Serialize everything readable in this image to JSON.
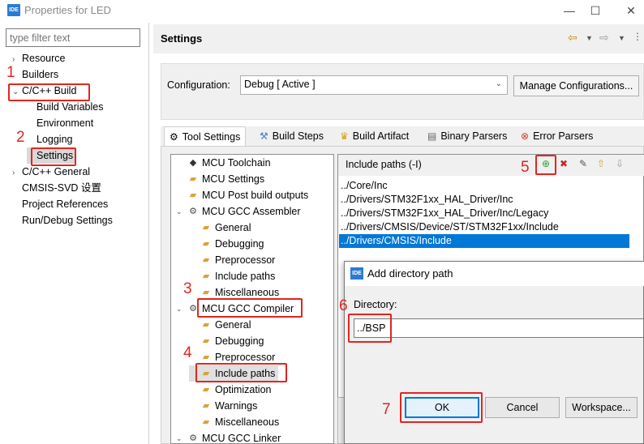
{
  "window": {
    "logo": "IDE",
    "title": "Properties for LED",
    "minimize": "—",
    "maximize": "☐",
    "close": "✕"
  },
  "filter": {
    "placeholder": "type filter text"
  },
  "nav": [
    {
      "label": "Resource",
      "expander": "›"
    },
    {
      "label": "Builders",
      "expander": ""
    },
    {
      "label": "C/C++ Build",
      "expander": "⌄"
    },
    {
      "label": "Build Variables",
      "expander": ""
    },
    {
      "label": "Environment",
      "expander": ""
    },
    {
      "label": "Logging",
      "expander": ""
    },
    {
      "label": "Settings",
      "expander": ""
    },
    {
      "label": "C/C++ General",
      "expander": "›"
    },
    {
      "label": "CMSIS-SVD 设置",
      "expander": ""
    },
    {
      "label": "Project References",
      "expander": ""
    },
    {
      "label": "Run/Debug Settings",
      "expander": ""
    }
  ],
  "settings": {
    "title": "Settings"
  },
  "configuration": {
    "label": "Configuration:",
    "value": "Debug  [ Active ]",
    "manage_label": "Manage Configurations..."
  },
  "tabs": [
    {
      "label": "Tool Settings",
      "icon": "gear-icon"
    },
    {
      "label": "Build Steps",
      "icon": "build-steps-icon"
    },
    {
      "label": "Build Artifact",
      "icon": "trophy-icon"
    },
    {
      "label": "Binary Parsers",
      "icon": "document-icon"
    },
    {
      "label": "Error Parsers",
      "icon": "error-icon"
    }
  ],
  "tool_tree": [
    {
      "label": "MCU Toolchain",
      "icon": "chip-icon"
    },
    {
      "label": "MCU Settings",
      "icon": "folder-gear-icon"
    },
    {
      "label": "MCU Post build outputs",
      "icon": "folder-gear-icon"
    },
    {
      "label": "MCU GCC Assembler",
      "icon": "gear-icon"
    },
    {
      "label": "General",
      "icon": "folder-gear-icon"
    },
    {
      "label": "Debugging",
      "icon": "folder-gear-icon"
    },
    {
      "label": "Preprocessor",
      "icon": "folder-gear-icon"
    },
    {
      "label": "Include paths",
      "icon": "folder-gear-icon"
    },
    {
      "label": "Miscellaneous",
      "icon": "folder-gear-icon"
    },
    {
      "label": "MCU GCC Compiler",
      "icon": "gear-icon"
    },
    {
      "label": "General",
      "icon": "folder-gear-icon"
    },
    {
      "label": "Debugging",
      "icon": "folder-gear-icon"
    },
    {
      "label": "Preprocessor",
      "icon": "folder-gear-icon"
    },
    {
      "label": "Include paths",
      "icon": "folder-gear-icon"
    },
    {
      "label": "Optimization",
      "icon": "folder-gear-icon"
    },
    {
      "label": "Warnings",
      "icon": "folder-gear-icon"
    },
    {
      "label": "Miscellaneous",
      "icon": "folder-gear-icon"
    },
    {
      "label": "MCU GCC Linker",
      "icon": "gear-icon"
    }
  ],
  "include_paths": {
    "title": "Include paths (-I)",
    "items": [
      "../Core/Inc",
      "../Drivers/STM32F1xx_HAL_Driver/Inc",
      "../Drivers/STM32F1xx_HAL_Driver/Inc/Legacy",
      "../Drivers/CMSIS/Device/ST/STM32F1xx/Include",
      "../Drivers/CMSIS/Include"
    ]
  },
  "dialog": {
    "logo": "IDE",
    "title": "Add directory path",
    "directory_label": "Directory:",
    "directory_value": "../BSP",
    "ok_label": "OK",
    "cancel_label": "Cancel",
    "workspace_label": "Workspace..."
  },
  "annotations": [
    "1",
    "2",
    "3",
    "4",
    "5",
    "6",
    "7"
  ],
  "colors": {
    "annotation": "#e0261f",
    "selection": "#0078d7",
    "logo": "#2a7bd4"
  }
}
